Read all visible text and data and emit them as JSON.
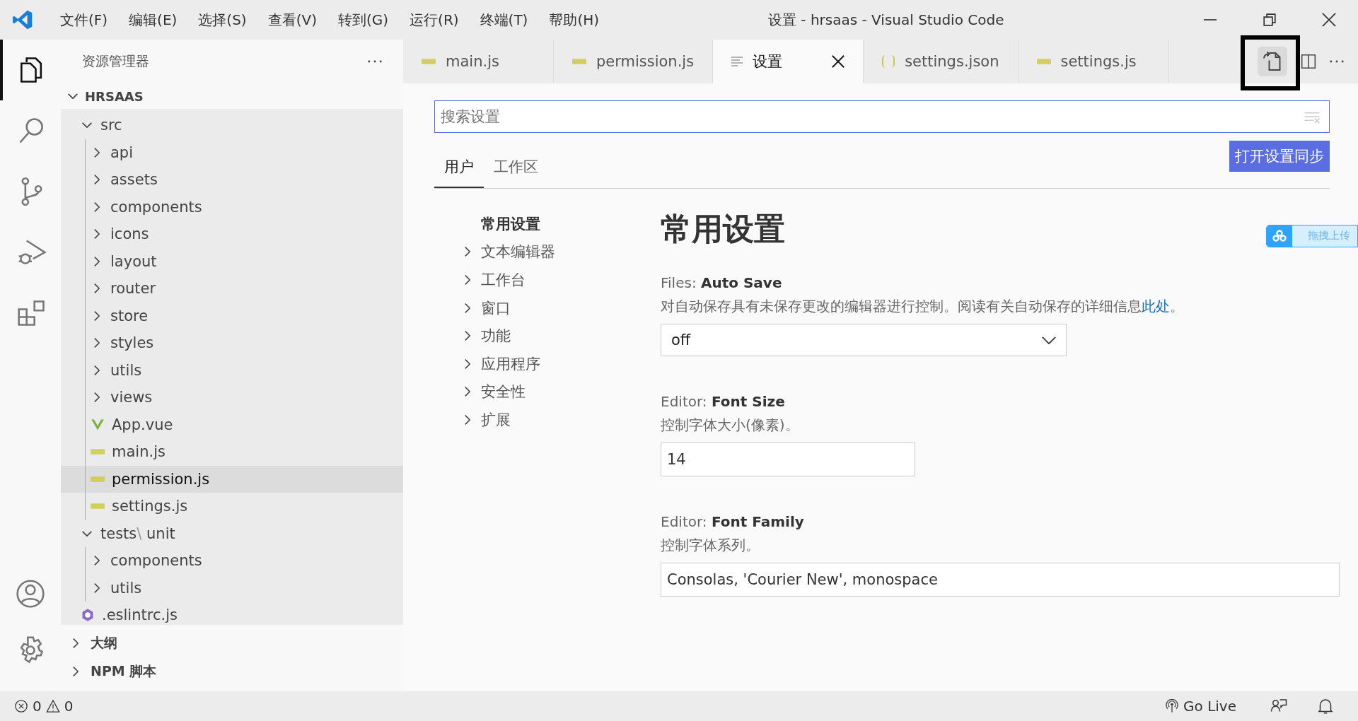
{
  "window": {
    "title": "设置 - hrsaas - Visual Studio Code"
  },
  "menu": [
    "文件(F)",
    "编辑(E)",
    "选择(S)",
    "查看(V)",
    "转到(G)",
    "运行(R)",
    "终端(T)",
    "帮助(H)"
  ],
  "activity_bar": [
    {
      "kind": "files",
      "selected": true
    },
    {
      "kind": "search",
      "selected": false
    },
    {
      "kind": "scm",
      "selected": false
    },
    {
      "kind": "debug",
      "selected": false
    },
    {
      "kind": "extensions",
      "selected": false
    }
  ],
  "sidebar": {
    "title": "资源管理器",
    "section": "HRSAAS",
    "tree": [
      {
        "label": "src",
        "kind": "folder",
        "expanded": true,
        "selected": false,
        "children": [
          {
            "label": "api",
            "kind": "folder",
            "expanded": false,
            "selected": false
          },
          {
            "label": "assets",
            "kind": "folder",
            "expanded": false,
            "selected": false
          },
          {
            "label": "components",
            "kind": "folder",
            "expanded": false,
            "selected": false
          },
          {
            "label": "icons",
            "kind": "folder",
            "expanded": false,
            "selected": false
          },
          {
            "label": "layout",
            "kind": "folder",
            "expanded": false,
            "selected": false
          },
          {
            "label": "router",
            "kind": "folder",
            "expanded": false,
            "selected": false
          },
          {
            "label": "store",
            "kind": "folder",
            "expanded": false,
            "selected": false
          },
          {
            "label": "styles",
            "kind": "folder",
            "expanded": false,
            "selected": false
          },
          {
            "label": "utils",
            "kind": "folder",
            "expanded": false,
            "selected": false
          },
          {
            "label": "views",
            "kind": "folder",
            "expanded": false,
            "selected": false
          },
          {
            "label": "App.vue",
            "kind": "vue",
            "selected": false
          },
          {
            "label": "main.js",
            "kind": "js",
            "selected": false
          },
          {
            "label": "permission.js",
            "kind": "js",
            "selected": true
          },
          {
            "label": "settings.js",
            "kind": "js",
            "selected": false
          }
        ]
      },
      {
        "label": "tests",
        "separator": "\\",
        "label_2": "unit",
        "kind": "folder",
        "expanded": true,
        "selected": false,
        "children": [
          {
            "label": "components",
            "kind": "folder",
            "expanded": false,
            "selected": false
          },
          {
            "label": "utils",
            "kind": "folder",
            "expanded": false,
            "selected": false
          }
        ]
      },
      {
        "label": ".eslintrc.js",
        "kind": "eslint",
        "selected": false
      }
    ],
    "panels": [
      {
        "label": "大纲",
        "expanded": false
      },
      {
        "label": "NPM 脚本",
        "expanded": false
      }
    ]
  },
  "tabs": [
    {
      "label": "main.js",
      "kind": "js",
      "selected": false
    },
    {
      "label": "permission.js",
      "kind": "js",
      "selected": false
    },
    {
      "label": "设置",
      "kind": "settings",
      "selected": true
    },
    {
      "label": "settings.json",
      "kind": "json",
      "selected": false
    },
    {
      "label": "settings.js",
      "kind": "js",
      "selected": false
    }
  ],
  "settings": {
    "search": {
      "placeholder": "搜索设置"
    },
    "scopes": [
      {
        "label": "用户",
        "selected": true
      },
      {
        "label": "工作区",
        "selected": false
      }
    ],
    "sync_button": "打开设置同步",
    "toc": [
      {
        "label": "常用设置",
        "kind": "header"
      },
      {
        "label": "文本编辑器",
        "kind": "group"
      },
      {
        "label": "工作台",
        "kind": "group"
      },
      {
        "label": "窗口",
        "kind": "group"
      },
      {
        "label": "功能",
        "kind": "group"
      },
      {
        "label": "应用程序",
        "kind": "group"
      },
      {
        "label": "安全性",
        "kind": "group"
      },
      {
        "label": "扩展",
        "kind": "group"
      }
    ],
    "heading": "常用设置",
    "items": [
      {
        "category": "Files: ",
        "name": "Auto Save",
        "description": "对自动保存具有未保存更改的编辑器进行控制。阅读有关自动保存的详细信息",
        "link": "此处",
        "description_end": "。",
        "kind": "dropdown",
        "value": "off"
      },
      {
        "category": "Editor: ",
        "name": "Font Size",
        "description": "控制字体大小(像素)。",
        "kind": "number",
        "value": "14"
      },
      {
        "category": "Editor: ",
        "name": "Font Family",
        "description": "控制字体系列。",
        "kind": "text",
        "value": "Consolas, 'Courier New', monospace"
      }
    ]
  },
  "upload_widget": {
    "label": "拖拽上传"
  },
  "status_bar": {
    "errors": "0",
    "warnings": "0",
    "go_live": "Go Live"
  }
}
